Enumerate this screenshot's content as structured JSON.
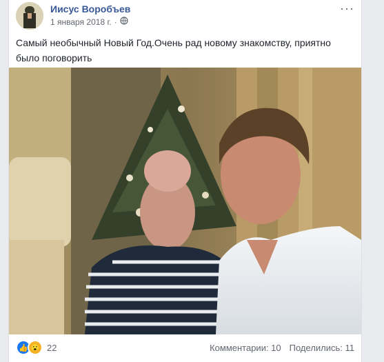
{
  "post": {
    "author": "Иисус Воробъев",
    "date": "1 января 2018 г.",
    "menu_label": "···",
    "text": "Самый необычный Новый Год.Очень рад новому знакомству, приятно было поговорить"
  },
  "footer": {
    "reactions_count": "22",
    "comments": "Комментарии: 10",
    "shares": "Поделились: 11"
  },
  "icons": {
    "privacy": "globe-icon",
    "reactions": [
      "like-icon",
      "wow-icon"
    ]
  }
}
